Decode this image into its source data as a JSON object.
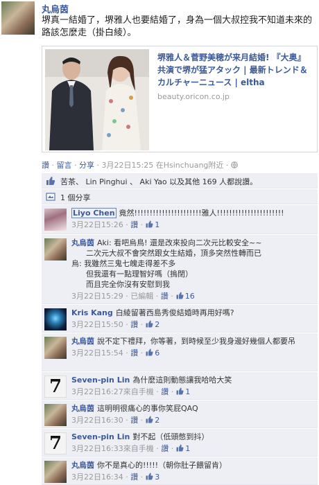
{
  "post": {
    "author": "丸烏茵",
    "text": "堺真一結婚了，堺雅人也要結婚了，身為一個大叔控我不知道未來的路該怎麼走（掛白綾）。"
  },
  "share": {
    "title": "堺雅人＆菅野美穂が来月結婚! 『大奥』共演で堺が猛アタック | 最新トレンド＆カルチャーニュース | eltha",
    "domain": "beauty.oricon.co.jp"
  },
  "actions": {
    "like": "讚",
    "comment": "留言",
    "share": "分享",
    "timestamp": "3月22日15:25",
    "location": "在Hsinchuang附近"
  },
  "likes": {
    "text": "苦茶、 Lin Pinghui 、 Aki Yao 以及其他 169 人都說讚。"
  },
  "shares": {
    "text": "1 個分享"
  },
  "comments": [
    {
      "author": "Liyo Chen",
      "text": "竟然!!!!!!!!!!!!!!!!!!!!!!雅人!!!!!!!!!!!!!!!!!!!!!!",
      "time": "3月22日15:26",
      "like_label": "讚",
      "likes": "1",
      "edited": ""
    },
    {
      "author": "丸烏茵",
      "text": "Aki: 看吧烏鳥! 還是改來投向二次元比較安全~~\n      二次元大叔不會突然跟女生結婚，頂多突然性轉而已\n烏: 我雖然三鬼七魄走得差不多\n      但我還有一點理智好嗎（摀閉）\n      而且完全你沒有安慰到我",
      "time": "3月22日15:29",
      "like_label": "讚",
      "likes": "16",
      "edited": "已編輯"
    },
    {
      "author": "Kris Kang",
      "text": "白綾留著西島秀俊結婚時再用好嗎?",
      "time": "3月22日15:50",
      "like_label": "讚",
      "likes": "2",
      "edited": ""
    },
    {
      "author": "丸烏茵",
      "text": "說不定下禮拜，你等著，到時候至少我身邊好幾個人都要吊",
      "time": "3月22日15:54",
      "like_label": "讚",
      "likes": "6",
      "edited": ""
    },
    {
      "author": "Seven-pin Lin",
      "text": "為什麼這則動態讓我哈哈大笑",
      "time": "3月22日16:27",
      "via": "來自手機",
      "like_label": "讚",
      "likes": "1",
      "edited": ""
    },
    {
      "author": "丸烏茵",
      "text": "這明明很痛心的事你笑屁QAQ",
      "time": "3月22日16:30",
      "like_label": "讚",
      "likes": "2",
      "edited": ""
    },
    {
      "author": "Seven-pin Lin",
      "text": "對不起（低頭憋到抖）",
      "time": "3月22日16:33",
      "via": "來自手機",
      "like_label": "讚",
      "likes": "1",
      "edited": ""
    },
    {
      "author": "丸烏茵",
      "text": "你不是真心的!!!!!（朝你肚子餵留肯）",
      "time": "3月22日16:34",
      "like_label": "讚",
      "likes": "3",
      "edited": ""
    }
  ]
}
